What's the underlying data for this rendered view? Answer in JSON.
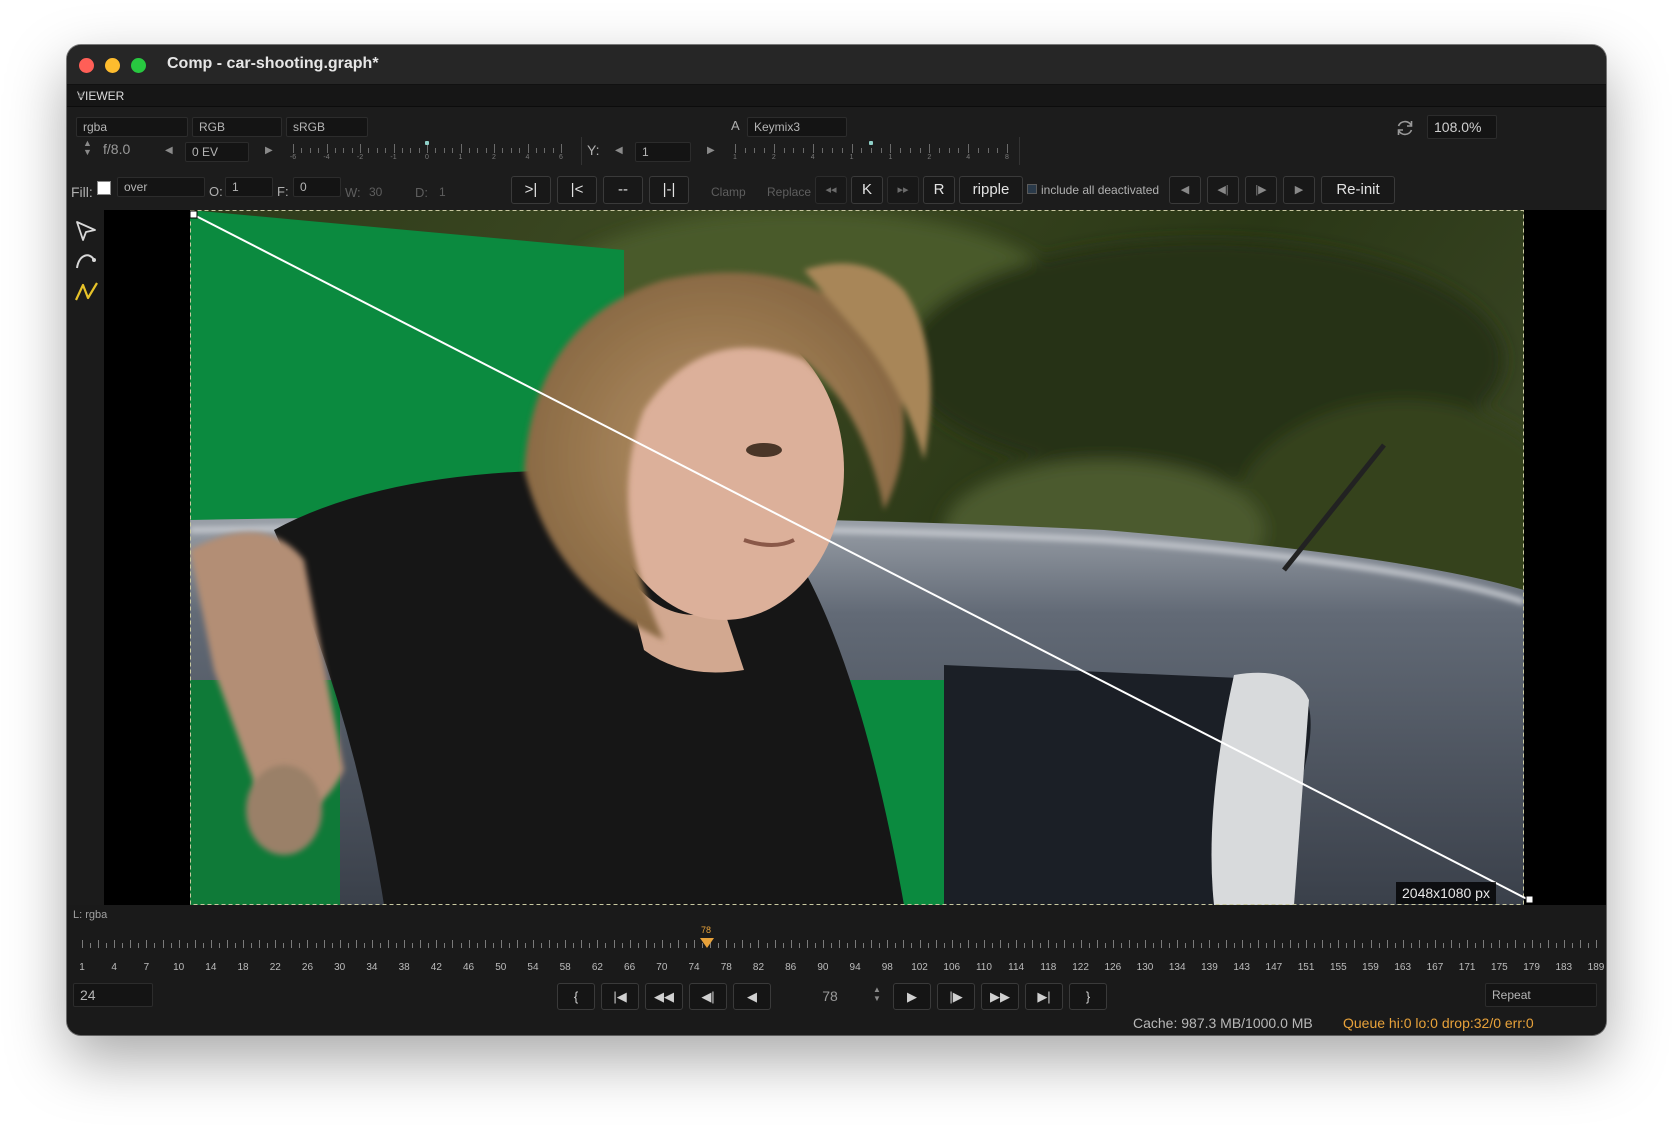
{
  "window": {
    "title": "Comp - car-shooting.graph*"
  },
  "panel": {
    "tab_label": "VIEWER",
    "close": "×"
  },
  "viewer_top": {
    "channels": "rgba",
    "colorspace": "RGB",
    "display": "sRGB",
    "input_a_label": "A",
    "input_a_value": "Keymix3",
    "zoom": "108.0%"
  },
  "exposure": {
    "fstop": "f/8.0",
    "ev_value": "0 EV",
    "ev_ticks": [
      "-6",
      "-4",
      "-2",
      "-1",
      "0",
      "1",
      "2",
      "4",
      "6"
    ],
    "y_label": "Y:",
    "y_value": "1",
    "y_ticks": [
      "1",
      "2",
      "4",
      "1",
      "1",
      "2",
      "4",
      "8"
    ]
  },
  "paint_toolbar": {
    "fill_label": "Fill:",
    "blend_mode": "over",
    "opacity_label": "O:",
    "opacity_value": "1",
    "feather_label": "F:",
    "feather_value": "0",
    "width_label": "W:",
    "width_value": "30",
    "duration_label": "D:",
    "duration_value": "1",
    "btn_next": ">|",
    "btn_prev": "|<",
    "btn_dash": "--",
    "btn_range": "|-|",
    "clamp": "Clamp",
    "replace": "Replace",
    "btn_rewind": "◂◂",
    "btn_k": "K",
    "btn_ff": "▸▸",
    "btn_r": "R",
    "ripple": "ripple",
    "include_deactivated": "include all deactivated",
    "reinit": "Re-init"
  },
  "viewport": {
    "resolution_label": "2048x1080 px",
    "layer_label": "L: rgba"
  },
  "timeline": {
    "labels": [
      "1",
      "4",
      "7",
      "10",
      "14",
      "18",
      "22",
      "26",
      "30",
      "34",
      "38",
      "42",
      "46",
      "50",
      "54",
      "58",
      "62",
      "66",
      "70",
      "74",
      "78",
      "82",
      "86",
      "90",
      "94",
      "98",
      "102",
      "106",
      "110",
      "114",
      "118",
      "122",
      "126",
      "130",
      "134",
      "139",
      "143",
      "147",
      "151",
      "155",
      "159",
      "163",
      "167",
      "171",
      "175",
      "179",
      "183",
      "189"
    ],
    "current_frame": "78",
    "playhead_color": "#e8a23a"
  },
  "playback": {
    "fps": "24",
    "frame": "78",
    "loop_mode": "Repeat",
    "btn_in": "{",
    "btn_first": "|◀",
    "btn_rewind": "◀◀",
    "btn_step_back": "◀|",
    "btn_play_back": "◀",
    "btn_play": "▶",
    "btn_step_fwd": "|▶",
    "btn_ff": "▶▶",
    "btn_last": "▶|",
    "btn_out": "}"
  },
  "status": {
    "cache": "Cache: 987.3 MB/1000.0 MB",
    "queue": "Queue hi:0 lo:0 drop:32/0 err:0"
  },
  "colors": {
    "accent_orange": "#e8a23a",
    "key_green": "#0b8a3f",
    "tool_yellow": "#e6c229"
  },
  "icons": [
    "select-arrow-icon",
    "bezier-tool-icon",
    "polyline-tool-icon",
    "refresh-icon",
    "fill-swatch-icon"
  ]
}
